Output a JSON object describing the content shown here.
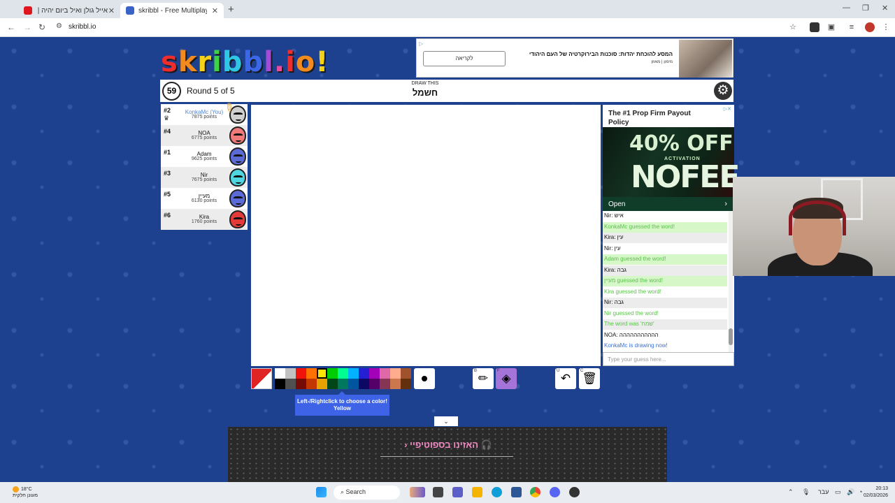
{
  "browser": {
    "tabs": [
      {
        "label": "אייל גולן ואיל ביום יהיה | YouTube",
        "active": false
      },
      {
        "label": "skribbl - Free Multiplayer D",
        "active": true
      }
    ],
    "url": "skribbl.io"
  },
  "ad_top": {
    "headline": "המסע להוכחת יהדות: סוכנות הבירוקרטיה של העם היהודי",
    "sub": "מימון | מאוזן",
    "button": "לקריאה"
  },
  "logo": {
    "text": "skribbl.io"
  },
  "game": {
    "timer": "59",
    "round": "Round 5 of 5",
    "draw_label": "DRAW THIS",
    "word": "חשמל"
  },
  "players": [
    {
      "rank": "#2",
      "name": "KonkaMc (You)",
      "points": "7875 points",
      "me": true,
      "face": "#cfcfcf"
    },
    {
      "rank": "#4",
      "name": "NOA",
      "points": "6775 points",
      "me": false,
      "face": "#f07a7a"
    },
    {
      "rank": "#1",
      "name": "Adam",
      "points": "9625 points",
      "me": false,
      "face": "#5b6bd6"
    },
    {
      "rank": "#3",
      "name": "Nir",
      "points": "7675 points",
      "me": false,
      "face": "#4fd6e0"
    },
    {
      "rank": "#5",
      "name": "מעיין",
      "points": "6130 points",
      "me": false,
      "face": "#5a6bd8"
    },
    {
      "rank": "#6",
      "name": "Kira",
      "points": "1760 points",
      "me": false,
      "face": "#e53a3a"
    }
  ],
  "ad_side": {
    "title": "The #1 Prop Firm Payout Policy",
    "big1": "40% OFF",
    "small": "ACTIVATION",
    "big2": "NOFEE",
    "open": "Open"
  },
  "chat": [
    {
      "text": "Nir: איש",
      "style": "plain"
    },
    {
      "text": "KonkaMc guessed the word!",
      "style": "green"
    },
    {
      "text": "Kira: עין",
      "style": "alt"
    },
    {
      "text": "Nir: עין",
      "style": "plain"
    },
    {
      "text": "Adam guessed the word!",
      "style": "green"
    },
    {
      "text": "Kira: גבה",
      "style": "alt"
    },
    {
      "text": "מעיין guessed the word!",
      "style": "green"
    },
    {
      "text": "Kira guessed the word!",
      "style": "green-white"
    },
    {
      "text": "Nir: גבה",
      "style": "alt"
    },
    {
      "text": "Nir guessed the word!",
      "style": "green-white"
    },
    {
      "text": "The word was 'שמח'",
      "style": "green-alt"
    },
    {
      "text": "NOA: ההההההההההה",
      "style": "plain"
    },
    {
      "text": "KonkaMc is drawing now!",
      "style": "blue"
    }
  ],
  "guess_placeholder": "Type your guess here...",
  "palette": [
    "#ffffff",
    "#c1c1c1",
    "#ef130b",
    "#ff7100",
    "#ffe400",
    "#00cc00",
    "#00ff91",
    "#00b2ff",
    "#231fd3",
    "#a300ba",
    "#df69a7",
    "#ffac8e",
    "#a0522d",
    "#000000",
    "#505050",
    "#740b07",
    "#c23800",
    "#e8a200",
    "#004619",
    "#00785d",
    "#00569e",
    "#0e0865",
    "#550069",
    "#873554",
    "#cc774d",
    "#63300d"
  ],
  "tooltip": {
    "line1": "Left-/Rightclick to choose a color!",
    "line2": "Yellow"
  },
  "tools": {
    "brush_key": "B",
    "fill_key": "F",
    "undo_key": "U",
    "clear_key": "C"
  },
  "spotify": {
    "text": "האזינו בספוטיפיי"
  },
  "taskbar": {
    "temp": "18°C",
    "weather": "מעונן חלקית",
    "search": "Search",
    "lang": "עבר",
    "time": "20:13",
    "date": "02/03/2026"
  }
}
